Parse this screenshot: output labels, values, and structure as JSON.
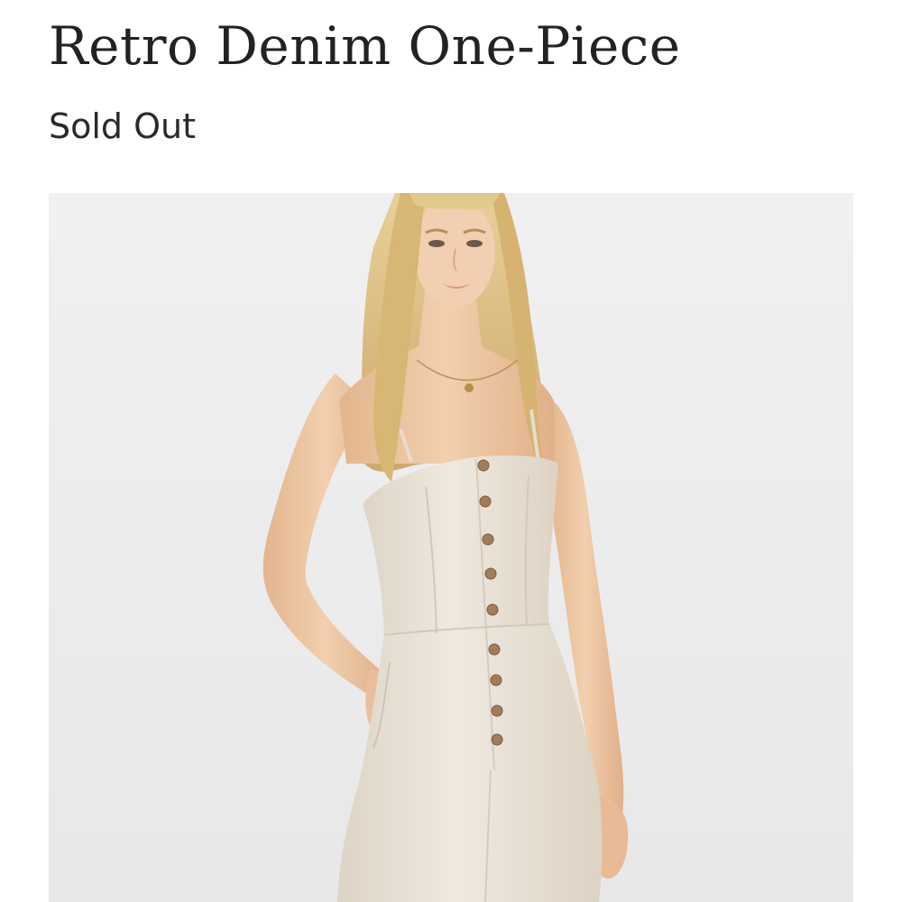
{
  "product": {
    "title": "Retro Denim One-Piece",
    "status": "Sold Out",
    "image_alt": "Model wearing a cream button-front denim jumpsuit"
  },
  "colors": {
    "title_text": "#222222",
    "status_text": "#2a2a2a",
    "image_background": "#ececec",
    "garment": "#eae3d7",
    "skin": "#efc9a6",
    "hair": "#dcbd7f",
    "button": "#a37d5a"
  }
}
